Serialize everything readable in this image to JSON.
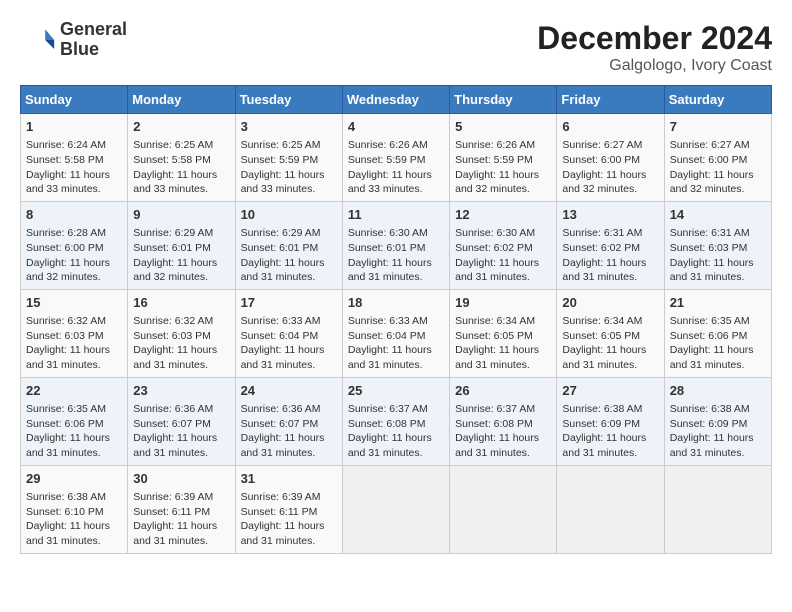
{
  "header": {
    "logo_line1": "General",
    "logo_line2": "Blue",
    "title": "December 2024",
    "subtitle": "Galgologo, Ivory Coast"
  },
  "calendar": {
    "days_of_week": [
      "Sunday",
      "Monday",
      "Tuesday",
      "Wednesday",
      "Thursday",
      "Friday",
      "Saturday"
    ],
    "weeks": [
      [
        {
          "day": "1",
          "info": "Sunrise: 6:24 AM\nSunset: 5:58 PM\nDaylight: 11 hours\nand 33 minutes."
        },
        {
          "day": "2",
          "info": "Sunrise: 6:25 AM\nSunset: 5:58 PM\nDaylight: 11 hours\nand 33 minutes."
        },
        {
          "day": "3",
          "info": "Sunrise: 6:25 AM\nSunset: 5:59 PM\nDaylight: 11 hours\nand 33 minutes."
        },
        {
          "day": "4",
          "info": "Sunrise: 6:26 AM\nSunset: 5:59 PM\nDaylight: 11 hours\nand 33 minutes."
        },
        {
          "day": "5",
          "info": "Sunrise: 6:26 AM\nSunset: 5:59 PM\nDaylight: 11 hours\nand 32 minutes."
        },
        {
          "day": "6",
          "info": "Sunrise: 6:27 AM\nSunset: 6:00 PM\nDaylight: 11 hours\nand 32 minutes."
        },
        {
          "day": "7",
          "info": "Sunrise: 6:27 AM\nSunset: 6:00 PM\nDaylight: 11 hours\nand 32 minutes."
        }
      ],
      [
        {
          "day": "8",
          "info": "Sunrise: 6:28 AM\nSunset: 6:00 PM\nDaylight: 11 hours\nand 32 minutes."
        },
        {
          "day": "9",
          "info": "Sunrise: 6:29 AM\nSunset: 6:01 PM\nDaylight: 11 hours\nand 32 minutes."
        },
        {
          "day": "10",
          "info": "Sunrise: 6:29 AM\nSunset: 6:01 PM\nDaylight: 11 hours\nand 31 minutes."
        },
        {
          "day": "11",
          "info": "Sunrise: 6:30 AM\nSunset: 6:01 PM\nDaylight: 11 hours\nand 31 minutes."
        },
        {
          "day": "12",
          "info": "Sunrise: 6:30 AM\nSunset: 6:02 PM\nDaylight: 11 hours\nand 31 minutes."
        },
        {
          "day": "13",
          "info": "Sunrise: 6:31 AM\nSunset: 6:02 PM\nDaylight: 11 hours\nand 31 minutes."
        },
        {
          "day": "14",
          "info": "Sunrise: 6:31 AM\nSunset: 6:03 PM\nDaylight: 11 hours\nand 31 minutes."
        }
      ],
      [
        {
          "day": "15",
          "info": "Sunrise: 6:32 AM\nSunset: 6:03 PM\nDaylight: 11 hours\nand 31 minutes."
        },
        {
          "day": "16",
          "info": "Sunrise: 6:32 AM\nSunset: 6:03 PM\nDaylight: 11 hours\nand 31 minutes."
        },
        {
          "day": "17",
          "info": "Sunrise: 6:33 AM\nSunset: 6:04 PM\nDaylight: 11 hours\nand 31 minutes."
        },
        {
          "day": "18",
          "info": "Sunrise: 6:33 AM\nSunset: 6:04 PM\nDaylight: 11 hours\nand 31 minutes."
        },
        {
          "day": "19",
          "info": "Sunrise: 6:34 AM\nSunset: 6:05 PM\nDaylight: 11 hours\nand 31 minutes."
        },
        {
          "day": "20",
          "info": "Sunrise: 6:34 AM\nSunset: 6:05 PM\nDaylight: 11 hours\nand 31 minutes."
        },
        {
          "day": "21",
          "info": "Sunrise: 6:35 AM\nSunset: 6:06 PM\nDaylight: 11 hours\nand 31 minutes."
        }
      ],
      [
        {
          "day": "22",
          "info": "Sunrise: 6:35 AM\nSunset: 6:06 PM\nDaylight: 11 hours\nand 31 minutes."
        },
        {
          "day": "23",
          "info": "Sunrise: 6:36 AM\nSunset: 6:07 PM\nDaylight: 11 hours\nand 31 minutes."
        },
        {
          "day": "24",
          "info": "Sunrise: 6:36 AM\nSunset: 6:07 PM\nDaylight: 11 hours\nand 31 minutes."
        },
        {
          "day": "25",
          "info": "Sunrise: 6:37 AM\nSunset: 6:08 PM\nDaylight: 11 hours\nand 31 minutes."
        },
        {
          "day": "26",
          "info": "Sunrise: 6:37 AM\nSunset: 6:08 PM\nDaylight: 11 hours\nand 31 minutes."
        },
        {
          "day": "27",
          "info": "Sunrise: 6:38 AM\nSunset: 6:09 PM\nDaylight: 11 hours\nand 31 minutes."
        },
        {
          "day": "28",
          "info": "Sunrise: 6:38 AM\nSunset: 6:09 PM\nDaylight: 11 hours\nand 31 minutes."
        }
      ],
      [
        {
          "day": "29",
          "info": "Sunrise: 6:38 AM\nSunset: 6:10 PM\nDaylight: 11 hours\nand 31 minutes."
        },
        {
          "day": "30",
          "info": "Sunrise: 6:39 AM\nSunset: 6:11 PM\nDaylight: 11 hours\nand 31 minutes."
        },
        {
          "day": "31",
          "info": "Sunrise: 6:39 AM\nSunset: 6:11 PM\nDaylight: 11 hours\nand 31 minutes."
        },
        {
          "day": "",
          "info": ""
        },
        {
          "day": "",
          "info": ""
        },
        {
          "day": "",
          "info": ""
        },
        {
          "day": "",
          "info": ""
        }
      ]
    ]
  }
}
